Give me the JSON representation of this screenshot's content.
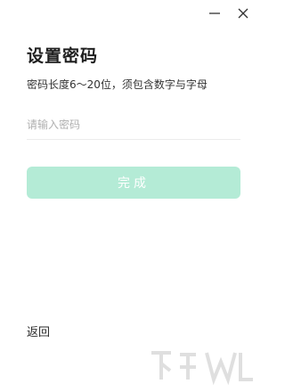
{
  "window": {
    "minimize_icon": "minimize-icon",
    "close_icon": "close-icon"
  },
  "header": {
    "title": "设置密码",
    "subtitle": "密码长度6～20位，须包含数字与字母"
  },
  "form": {
    "password_placeholder": "请输入密码",
    "password_value": "",
    "submit_label": "完成"
  },
  "footer": {
    "back_label": "返回"
  },
  "colors": {
    "submit_bg": "#b4ebd6",
    "text": "#1f1f1f",
    "placeholder": "#b0b0b0"
  }
}
